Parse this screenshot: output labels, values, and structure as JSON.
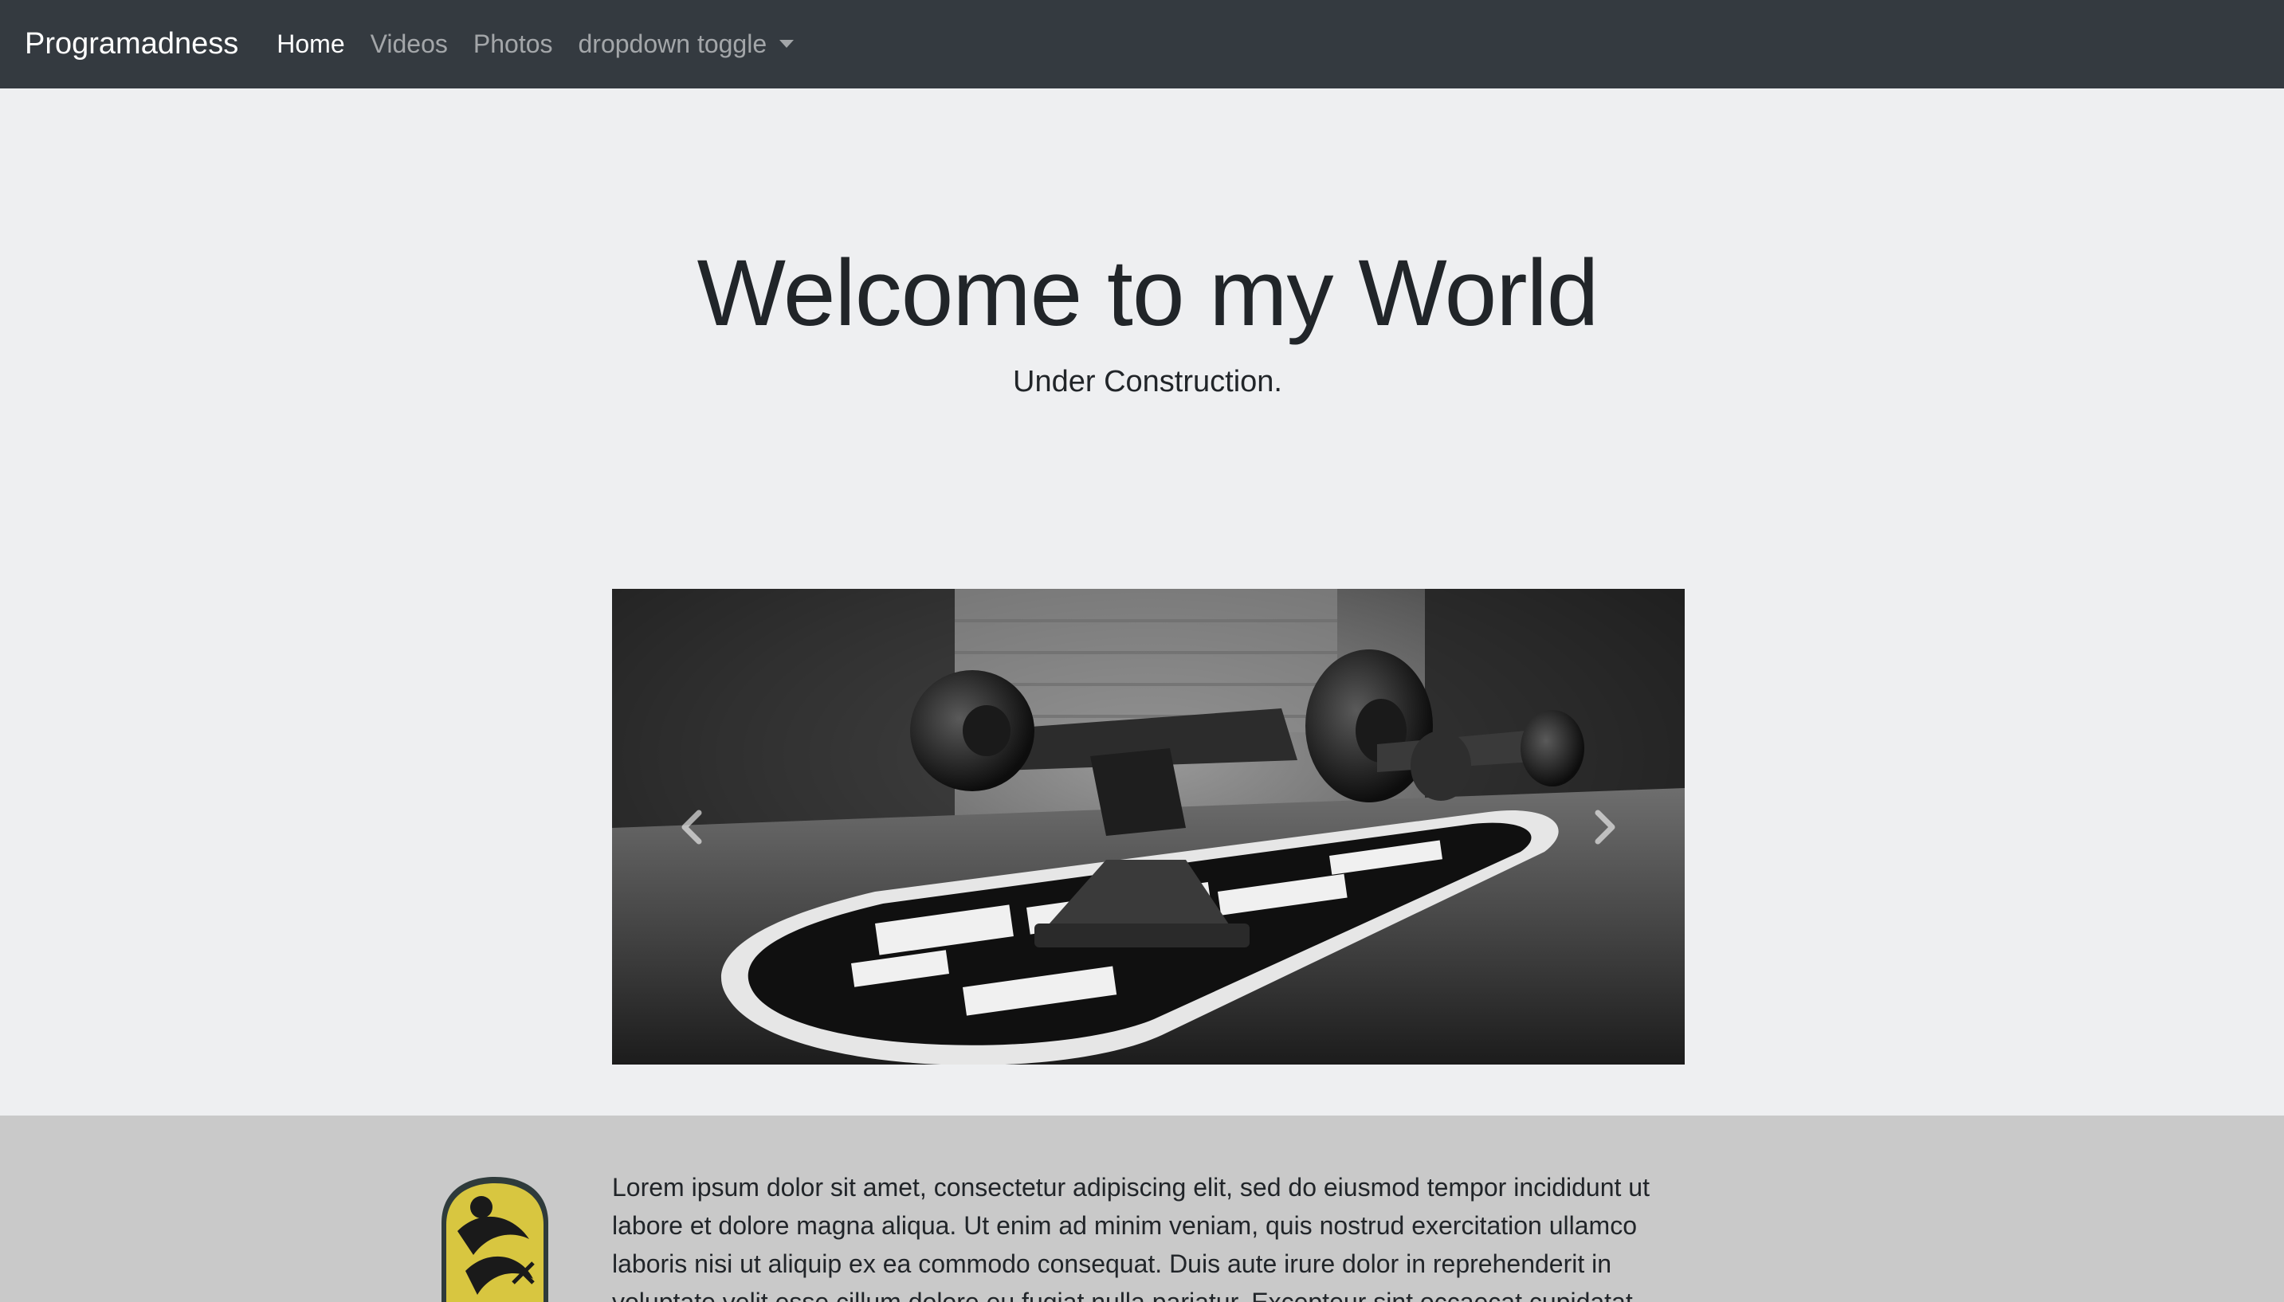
{
  "navbar": {
    "brand": "Programadness",
    "links": [
      {
        "label": "Home",
        "active": true
      },
      {
        "label": "Videos",
        "active": false
      },
      {
        "label": "Photos",
        "active": false
      }
    ],
    "dropdown": {
      "label": "dropdown toggle"
    }
  },
  "hero": {
    "title": "Welcome to my World",
    "subtitle": "Under Construction."
  },
  "carousel": {
    "slide_image": "black-and-white skateboard photo",
    "prev_icon": "chevron-left-icon",
    "next_icon": "chevron-right-icon"
  },
  "content": {
    "thumbnail": "skateboard-deck-image",
    "text": "Lorem ipsum dolor sit amet, consectetur adipiscing elit, sed do eiusmod tempor incididunt ut labore et dolore magna aliqua. Ut enim ad minim veniam, quis nostrud exercitation ullamco laboris nisi ut aliquip ex ea commodo consequat. Duis aute irure dolor in reprehenderit in voluptate velit esse cillum dolore eu fugiat nulla pariatur. Excepteur sint occaecat cupidatat"
  },
  "colors": {
    "navbar_bg": "#343a40",
    "page_bg": "#eeeff1",
    "lower_bg": "#c9c9c9",
    "text": "#212529"
  }
}
